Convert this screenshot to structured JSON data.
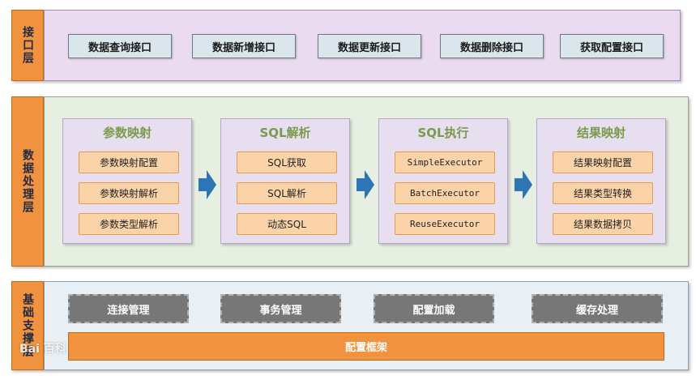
{
  "layers": {
    "interface": {
      "label": "接口层"
    },
    "processing": {
      "label": "数据处理层"
    },
    "foundation": {
      "label": "基础支撑层"
    }
  },
  "interface_apis": [
    "数据查询接口",
    "数据新增接口",
    "数据更新接口",
    "数据删除接口",
    "获取配置接口"
  ],
  "modules": [
    {
      "title": "参数映射",
      "items": [
        "参数映射配置",
        "参数映射解析",
        "参数类型解析"
      ]
    },
    {
      "title": "SQL解析",
      "items": [
        "SQL获取",
        "SQL解析",
        "动态SQL"
      ]
    },
    {
      "title": "SQL执行",
      "items": [
        "SimpleExecutor",
        "BatchExecutor",
        "ReuseExecutor"
      ]
    },
    {
      "title": "结果映射",
      "items": [
        "结果映射配置",
        "结果类型转换",
        "结果数据拷贝"
      ]
    }
  ],
  "foundation_items": [
    "连接管理",
    "事务管理",
    "配置加载",
    "缓存处理"
  ],
  "config_framework": "配置框架",
  "watermark": {
    "text": "Bai 百科"
  },
  "colors": {
    "layer_label": "#f0923e",
    "module_title": "#7b9a4a",
    "item_fill": "#fad4a8",
    "arrow": "#2e75b6",
    "infra_fill": "#777777"
  }
}
